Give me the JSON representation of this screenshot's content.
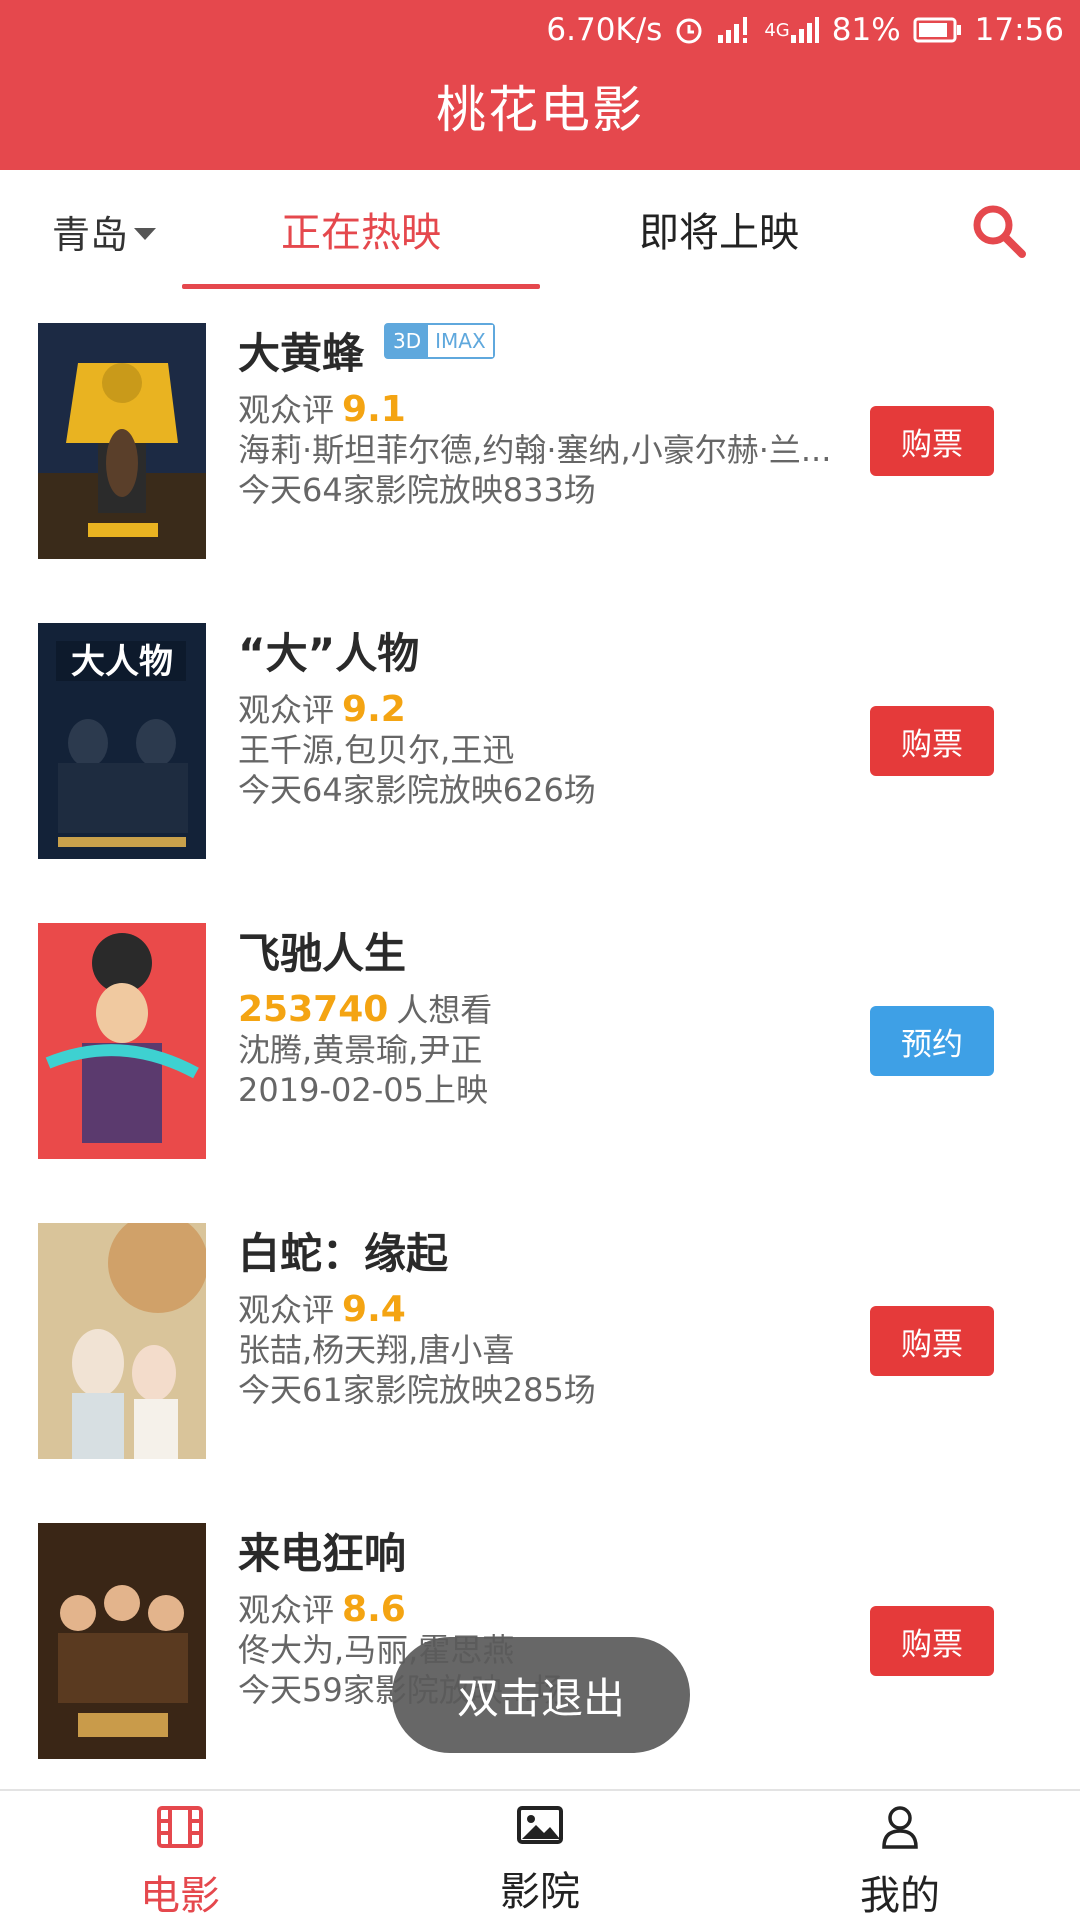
{
  "status_bar": {
    "network_speed": "6.70K/s",
    "battery": "81%",
    "time": "17:56",
    "network_type": "4G"
  },
  "header": {
    "title": "桃花电影"
  },
  "tabs": {
    "city": "青岛",
    "now_showing": "正在热映",
    "coming_soon": "即将上映"
  },
  "icons": {
    "search": "search-icon",
    "film": "film-icon",
    "picture": "picture-icon",
    "user": "user-icon",
    "alarm": "alarm-icon",
    "signal": "signal-icon",
    "battery": "battery-icon"
  },
  "colors": {
    "brand_red": "#e5484d",
    "buy_red": "#e53a3a",
    "reserve_blue": "#3ea0e6",
    "score_orange": "#f4a412"
  },
  "movies": [
    {
      "title": "大黄蜂",
      "tag_3d": "3D",
      "tag_imax": "IMAX",
      "rating_label": "观众评",
      "score": "9.1",
      "cast": "海莉·斯坦菲尔德,约翰·塞纳,小豪尔赫·兰...",
      "showings": "今天64家影院放映833场",
      "button": "购票"
    },
    {
      "title": "“大”人物",
      "rating_label": "观众评",
      "score": "9.2",
      "cast": "王千源,包贝尔,王迅",
      "showings": "今天64家影院放映626场",
      "button": "购票"
    },
    {
      "title": "飞驰人生",
      "want_count": "253740",
      "want_label": "人想看",
      "cast": "沈腾,黄景瑜,尹正",
      "release": "2019-02-05上映",
      "button": "预约"
    },
    {
      "title": "白蛇：缘起",
      "rating_label": "观众评",
      "score": "9.4",
      "cast": "张喆,杨天翔,唐小喜",
      "showings": "今天61家影院放映285场",
      "button": "购票"
    },
    {
      "title": "来电狂响",
      "rating_label": "观众评",
      "score": "8.6",
      "cast": "佟大为,马丽,霍思燕",
      "showings": "今天59家影院放映...场",
      "button": "购票"
    }
  ],
  "toast": "双击退出",
  "bottom_nav": {
    "movies": "电影",
    "cinemas": "影院",
    "mine": "我的"
  }
}
